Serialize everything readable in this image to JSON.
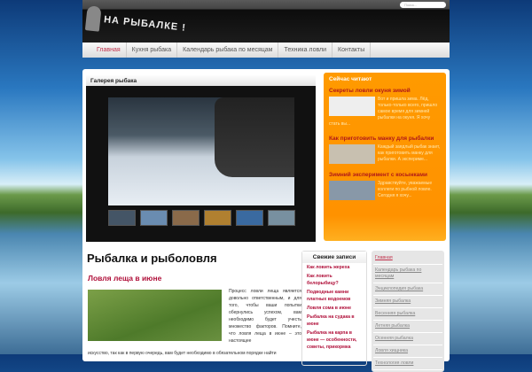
{
  "header": {
    "logo": "НА РЫБАЛКЕ !",
    "search_placeholder": "Поиск..."
  },
  "nav": [
    "Главная",
    "Кухня рыбака",
    "Календарь рыбака по месяцам",
    "Техника ловли",
    "Контакты"
  ],
  "gallery": {
    "title": "Галерея рыбака"
  },
  "reading": {
    "title": "Сейчас читают",
    "items": [
      {
        "title": "Секреты ловли окуня зимой",
        "excerpt": "Вот и пришла зима. Лёд, только-только всего, пришло самое время для зимней рыбалки на окуня. Я хочу стать вы..."
      },
      {
        "title": "Как приготовить манку для рыбалки",
        "excerpt": "Каждый заядлый рыбак знает, как приготовить манку для рыбалки. А экспериме..."
      },
      {
        "title": "Зимний эксперимент с косынками",
        "excerpt": "Здравствуйте, уважаемые коллеги по рыбной ловле. Сегодня я хочу..."
      }
    ]
  },
  "main": {
    "title": "Рыбалка и рыболовля",
    "post_title": "Ловля леща в июне",
    "post_text": "Процесс ловли леща является довольно ответственным, и для того, чтобы ваши попытки обернулись успехом, вам необходимо будет учесть множество факторов. Помните, что ловля леща в июне – это настоящее",
    "post_more": "искусство, так как в первую очередь, вам будет необходимо в обязательном порядке найти"
  },
  "fresh": {
    "title": "Свежие записи",
    "items": [
      "Как ловить жереха",
      "Как ловить белорыбицу?",
      "Подводные камни платных водоемов",
      "Ловля сома в июне",
      "Рыбалка на судака в июне",
      "Рыбалка на карпа в июне — особенности, советы, прикормка"
    ]
  },
  "rnav": [
    "Главная",
    "Календарь рыбака по месяцам",
    "Энциклопедия рыбака",
    "Зимняя рыбалка",
    "Весенняя рыбалка",
    "Летняя рыбалка",
    "Осенняя рыбалка",
    "Ловля хищника",
    "Технология ловли"
  ]
}
